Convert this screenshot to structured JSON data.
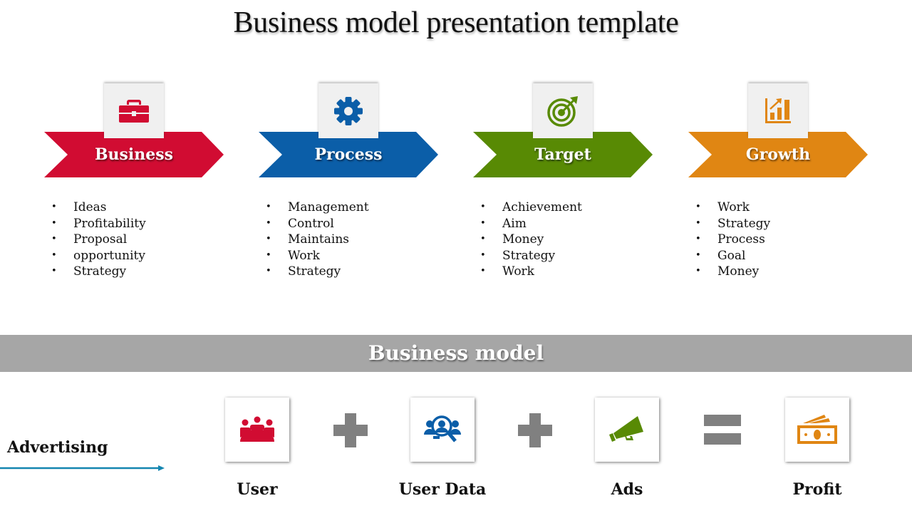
{
  "title": "Business model presentation template",
  "stages": [
    {
      "label": "Business",
      "icon": "briefcase-icon",
      "color": "#d10c32",
      "line_color": "#8b1128",
      "items": [
        "Ideas",
        "Profitability",
        "Proposal",
        "opportunity",
        "Strategy"
      ]
    },
    {
      "label": "Process",
      "icon": "gear-icon",
      "color": "#0b5ea8",
      "line_color": "#0f3f6e",
      "items": [
        "Management",
        "Control",
        "Maintains",
        "Work",
        "Strategy"
      ]
    },
    {
      "label": "Target",
      "icon": "target-icon",
      "color": "#588a04",
      "line_color": "#3f6104",
      "items": [
        "Achievement",
        "Aim",
        "Money",
        "Strategy",
        "Work"
      ]
    },
    {
      "label": "Growth",
      "icon": "growth-chart-icon",
      "color": "#e08613",
      "line_color": "#9c5a0e",
      "items": [
        "Work",
        "Strategy",
        "Process",
        "Goal",
        "Money"
      ]
    }
  ],
  "band": {
    "label": "Business model",
    "color": "#a6a6a6"
  },
  "advertising": {
    "label": "Advertising",
    "arrow_color": "#1486b0"
  },
  "equation": {
    "items": [
      {
        "label": "User",
        "icon": "group-meeting-icon",
        "color": "#d10c32"
      },
      {
        "label": "User Data",
        "icon": "user-search-icon",
        "color": "#0b5ea8"
      },
      {
        "label": "Ads",
        "icon": "megaphone-icon",
        "color": "#588a04"
      },
      {
        "label": "Profit",
        "icon": "money-icon",
        "color": "#e08613"
      }
    ],
    "operators": [
      {
        "symbol": "+",
        "icon": "plus-icon"
      },
      {
        "symbol": "+",
        "icon": "plus-icon"
      },
      {
        "symbol": "=",
        "icon": "equals-icon"
      }
    ],
    "operator_color": "#808080"
  }
}
